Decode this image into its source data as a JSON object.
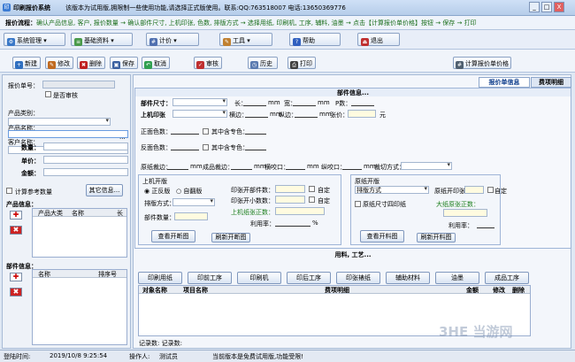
{
  "window": {
    "title": "印刷报价系统",
    "notice": "该版本为试用版,拥限制一些使用功能,请选择正式版使用。联系:QQ:763518007  电话:13650369776",
    "min": "_",
    "max": "□",
    "close": "X"
  },
  "flow": {
    "label": "报价流程：",
    "steps": "确认产品信息, 客户, 报价数量 → 确认部件尺寸, 上机印张, 色数, 排版方式 → 选择用纸, 印刷机, 工序, 辅料, 油墨 → 点击【计算报价单价格】按钮 → 保存 → 打印"
  },
  "menu": [
    {
      "label": "系统管理"
    },
    {
      "label": "基础资料"
    },
    {
      "label": "计价"
    },
    {
      "label": "工具"
    },
    {
      "label": "帮助"
    },
    {
      "label": "退出"
    }
  ],
  "toolbar": {
    "new": "新建",
    "edit": "修改",
    "delete": "删除",
    "save": "保存",
    "cancel": "取消",
    "audit": "审核",
    "history": "历史",
    "print": "打印",
    "calc": "计算报价单价格"
  },
  "left": {
    "quote_no": "报价单号：",
    "not_audited": "是否审核",
    "product_type": "产品类别：",
    "product_name": "产品名称：",
    "customer_name": "客户名称：",
    "dots": "...",
    "qty": "数量：",
    "unit_price": "单价：",
    "amount": "金额：",
    "calc_ref_qty": "计算参考数量",
    "other_info": "其它信息...",
    "product_info": "产品信息：",
    "product_cols": [
      "产品大类",
      "名称",
      "长"
    ],
    "part_info": "部件信息：",
    "part_cols": [
      "名称",
      "排序号"
    ],
    "add": "✚",
    "remove": "✖"
  },
  "right": {
    "tabs": [
      "报价单信息",
      "费项明细"
    ],
    "part_header": "部件信息...",
    "part_size": "部件尺寸：",
    "long": "长：",
    "mm": "mm",
    "wide": "宽：",
    "p_count": "P数：",
    "press_sheet": "上机印张",
    "h_margin": "横边：",
    "v_margin": "纵边：",
    "sheet_count": "张价：",
    "yuan": "元",
    "front_colors": "正面色数：",
    "back_colors": "反面色数：",
    "spot_front": "其中含专色：",
    "spot_back": "其中含专色：",
    "paper_trim": "原纸裁边：",
    "finish_trim": "成品裁边：",
    "h_mouth": "横咬口：",
    "v_mouth": "纵咬口：",
    "cut_method": "裁切方式：",
    "press_layout": {
      "title": "上机开版",
      "normal": "正反版",
      "auto": "自翻版",
      "layout_method": "排版方式：",
      "part_count": "部件数量：",
      "press_opens": "印张开部件数：",
      "press_min": "印张开小数数：",
      "press_total": "上机纸张正数：",
      "utilization": "利用率：",
      "percent": "%",
      "custom1": "自定",
      "custom2": "自定",
      "view": "查看开断图",
      "refresh": "刷新开断图"
    },
    "paper_layout": {
      "title": "原纸开版",
      "layout_method": "排版方式",
      "paper_opens": "原纸开印张数：",
      "size_print": "原纸尺寸四印纸",
      "big_total": "大纸原张正数：",
      "utilization": "利用率：",
      "custom": "自定",
      "view": "查看开料图",
      "refresh": "刷新开料图"
    },
    "process_header": "用料, 工艺...",
    "process_buttons": [
      "印刷用纸",
      "印前工序",
      "印刷机",
      "印后工序",
      "印张裱纸",
      "辅助材料",
      "油墨",
      "成品工序"
    ],
    "cost_cols": [
      "对象名称",
      "项目名称",
      "费项明细",
      "金额",
      "修改",
      "删除"
    ],
    "record_count": "记录数:  记录数:"
  },
  "status": {
    "login_label": "登陆时间:",
    "login_time": "2019/10/8 9:25:54",
    "operator_label": "操作人:",
    "operator": "测试员",
    "trial": "当前版本是免费试用版,功能受限!"
  },
  "watermark": "3HE 当游网"
}
